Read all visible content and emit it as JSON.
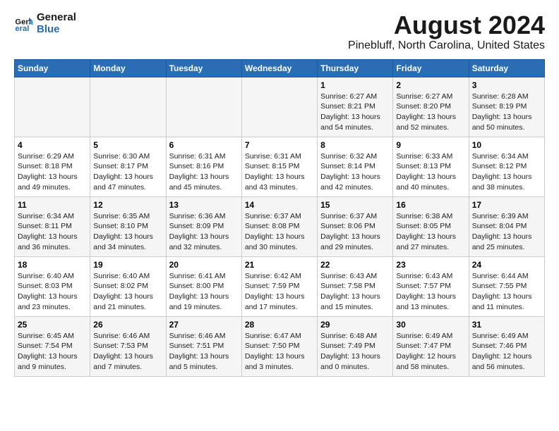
{
  "logo": {
    "text_general": "General",
    "text_blue": "Blue"
  },
  "title": "August 2024",
  "subtitle": "Pinebluff, North Carolina, United States",
  "days_of_week": [
    "Sunday",
    "Monday",
    "Tuesday",
    "Wednesday",
    "Thursday",
    "Friday",
    "Saturday"
  ],
  "weeks": [
    [
      {
        "day": "",
        "info": ""
      },
      {
        "day": "",
        "info": ""
      },
      {
        "day": "",
        "info": ""
      },
      {
        "day": "",
        "info": ""
      },
      {
        "day": "1",
        "info": "Sunrise: 6:27 AM\nSunset: 8:21 PM\nDaylight: 13 hours\nand 54 minutes."
      },
      {
        "day": "2",
        "info": "Sunrise: 6:27 AM\nSunset: 8:20 PM\nDaylight: 13 hours\nand 52 minutes."
      },
      {
        "day": "3",
        "info": "Sunrise: 6:28 AM\nSunset: 8:19 PM\nDaylight: 13 hours\nand 50 minutes."
      }
    ],
    [
      {
        "day": "4",
        "info": "Sunrise: 6:29 AM\nSunset: 8:18 PM\nDaylight: 13 hours\nand 49 minutes."
      },
      {
        "day": "5",
        "info": "Sunrise: 6:30 AM\nSunset: 8:17 PM\nDaylight: 13 hours\nand 47 minutes."
      },
      {
        "day": "6",
        "info": "Sunrise: 6:31 AM\nSunset: 8:16 PM\nDaylight: 13 hours\nand 45 minutes."
      },
      {
        "day": "7",
        "info": "Sunrise: 6:31 AM\nSunset: 8:15 PM\nDaylight: 13 hours\nand 43 minutes."
      },
      {
        "day": "8",
        "info": "Sunrise: 6:32 AM\nSunset: 8:14 PM\nDaylight: 13 hours\nand 42 minutes."
      },
      {
        "day": "9",
        "info": "Sunrise: 6:33 AM\nSunset: 8:13 PM\nDaylight: 13 hours\nand 40 minutes."
      },
      {
        "day": "10",
        "info": "Sunrise: 6:34 AM\nSunset: 8:12 PM\nDaylight: 13 hours\nand 38 minutes."
      }
    ],
    [
      {
        "day": "11",
        "info": "Sunrise: 6:34 AM\nSunset: 8:11 PM\nDaylight: 13 hours\nand 36 minutes."
      },
      {
        "day": "12",
        "info": "Sunrise: 6:35 AM\nSunset: 8:10 PM\nDaylight: 13 hours\nand 34 minutes."
      },
      {
        "day": "13",
        "info": "Sunrise: 6:36 AM\nSunset: 8:09 PM\nDaylight: 13 hours\nand 32 minutes."
      },
      {
        "day": "14",
        "info": "Sunrise: 6:37 AM\nSunset: 8:08 PM\nDaylight: 13 hours\nand 30 minutes."
      },
      {
        "day": "15",
        "info": "Sunrise: 6:37 AM\nSunset: 8:06 PM\nDaylight: 13 hours\nand 29 minutes."
      },
      {
        "day": "16",
        "info": "Sunrise: 6:38 AM\nSunset: 8:05 PM\nDaylight: 13 hours\nand 27 minutes."
      },
      {
        "day": "17",
        "info": "Sunrise: 6:39 AM\nSunset: 8:04 PM\nDaylight: 13 hours\nand 25 minutes."
      }
    ],
    [
      {
        "day": "18",
        "info": "Sunrise: 6:40 AM\nSunset: 8:03 PM\nDaylight: 13 hours\nand 23 minutes."
      },
      {
        "day": "19",
        "info": "Sunrise: 6:40 AM\nSunset: 8:02 PM\nDaylight: 13 hours\nand 21 minutes."
      },
      {
        "day": "20",
        "info": "Sunrise: 6:41 AM\nSunset: 8:00 PM\nDaylight: 13 hours\nand 19 minutes."
      },
      {
        "day": "21",
        "info": "Sunrise: 6:42 AM\nSunset: 7:59 PM\nDaylight: 13 hours\nand 17 minutes."
      },
      {
        "day": "22",
        "info": "Sunrise: 6:43 AM\nSunset: 7:58 PM\nDaylight: 13 hours\nand 15 minutes."
      },
      {
        "day": "23",
        "info": "Sunrise: 6:43 AM\nSunset: 7:57 PM\nDaylight: 13 hours\nand 13 minutes."
      },
      {
        "day": "24",
        "info": "Sunrise: 6:44 AM\nSunset: 7:55 PM\nDaylight: 13 hours\nand 11 minutes."
      }
    ],
    [
      {
        "day": "25",
        "info": "Sunrise: 6:45 AM\nSunset: 7:54 PM\nDaylight: 13 hours\nand 9 minutes."
      },
      {
        "day": "26",
        "info": "Sunrise: 6:46 AM\nSunset: 7:53 PM\nDaylight: 13 hours\nand 7 minutes."
      },
      {
        "day": "27",
        "info": "Sunrise: 6:46 AM\nSunset: 7:51 PM\nDaylight: 13 hours\nand 5 minutes."
      },
      {
        "day": "28",
        "info": "Sunrise: 6:47 AM\nSunset: 7:50 PM\nDaylight: 13 hours\nand 3 minutes."
      },
      {
        "day": "29",
        "info": "Sunrise: 6:48 AM\nSunset: 7:49 PM\nDaylight: 13 hours\nand 0 minutes."
      },
      {
        "day": "30",
        "info": "Sunrise: 6:49 AM\nSunset: 7:47 PM\nDaylight: 12 hours\nand 58 minutes."
      },
      {
        "day": "31",
        "info": "Sunrise: 6:49 AM\nSunset: 7:46 PM\nDaylight: 12 hours\nand 56 minutes."
      }
    ]
  ]
}
